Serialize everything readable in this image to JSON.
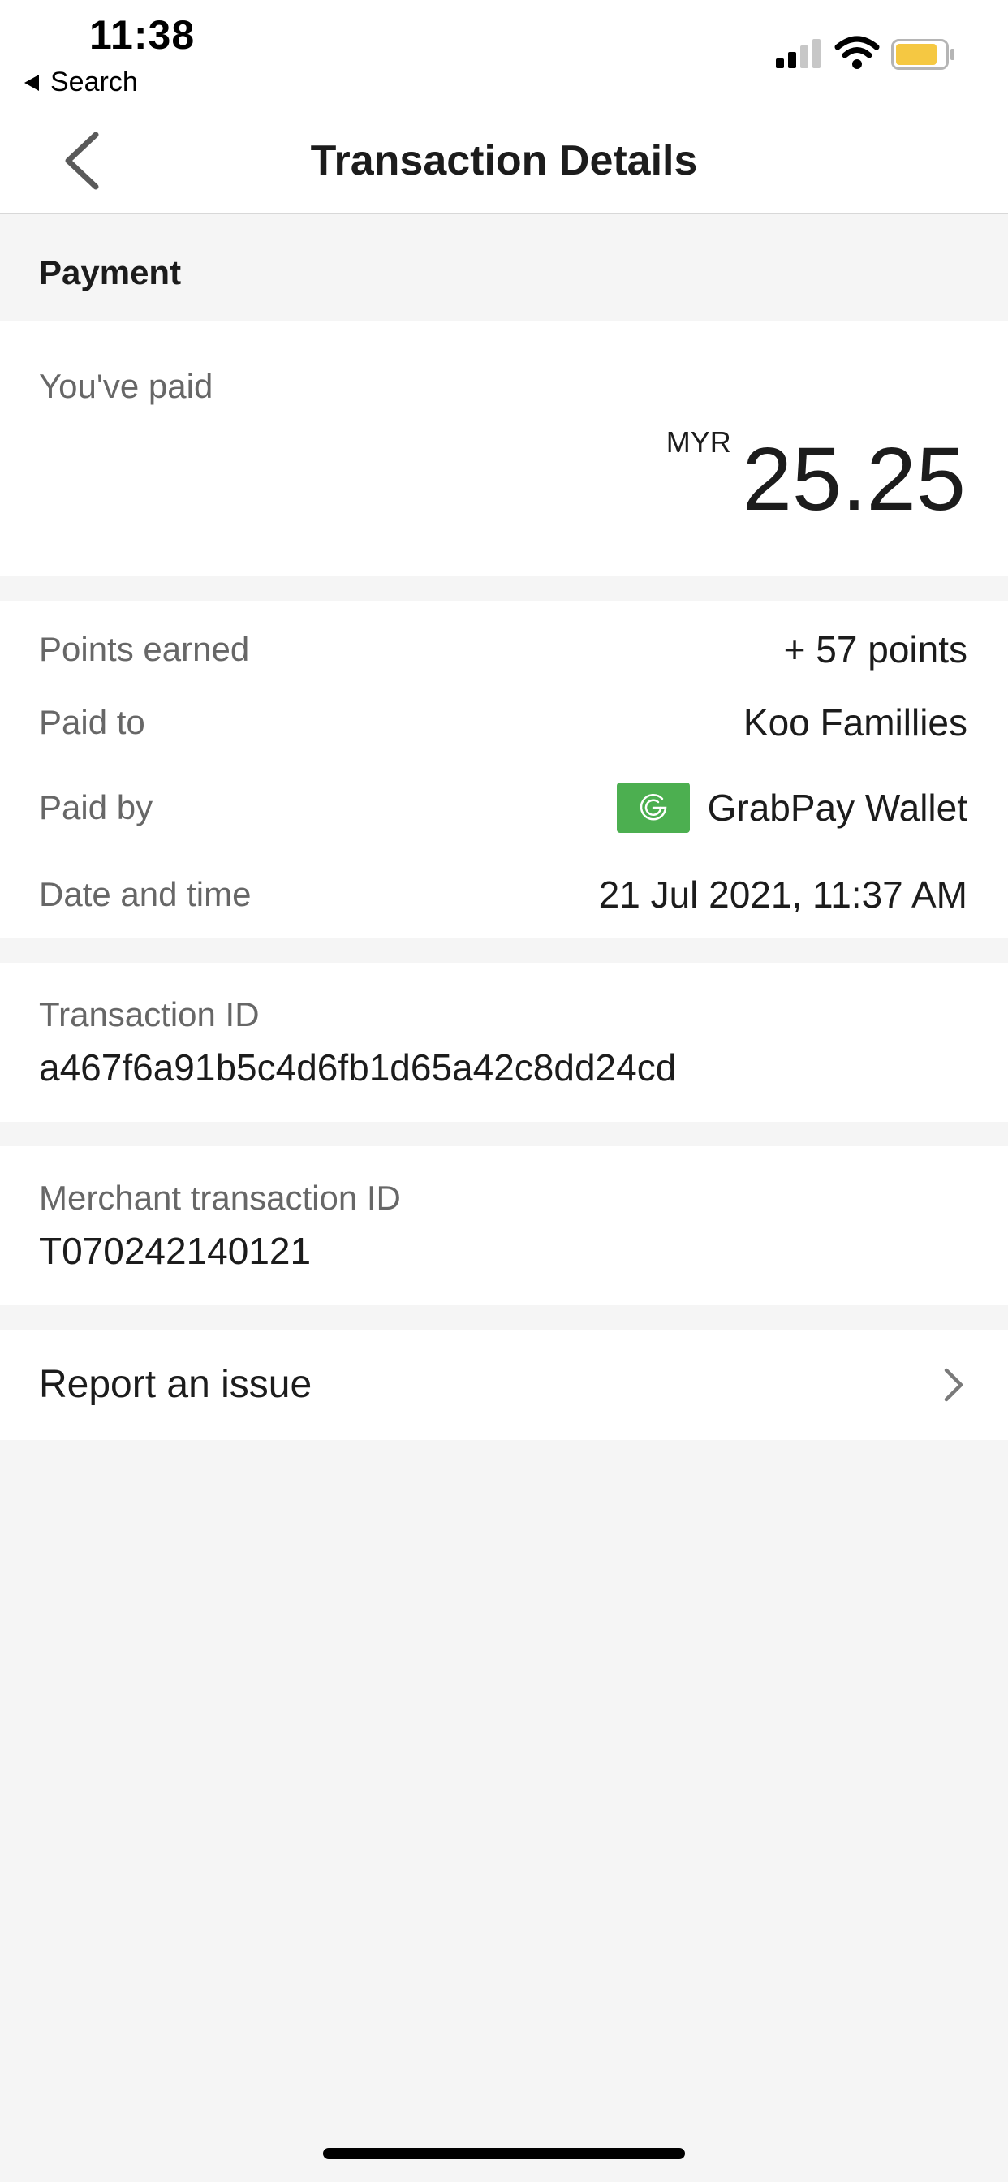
{
  "status_bar": {
    "time": "11:38",
    "back_label": "Search"
  },
  "nav": {
    "title": "Transaction Details"
  },
  "section": {
    "title": "Payment"
  },
  "payment": {
    "paid_label": "You've paid",
    "currency": "MYR",
    "amount": "25.25"
  },
  "details": {
    "points_label": "Points earned",
    "points_value": "+ 57 points",
    "paid_to_label": "Paid to",
    "paid_to_value": "Koo Famillies",
    "paid_by_label": "Paid by",
    "paid_by_value": "GrabPay Wallet",
    "datetime_label": "Date and time",
    "datetime_value": "21 Jul 2021, 11:37 AM"
  },
  "transaction": {
    "label": "Transaction ID",
    "value": "a467f6a91b5c4d6fb1d65a42c8dd24cd"
  },
  "merchant_transaction": {
    "label": "Merchant transaction ID",
    "value": "T070242140121"
  },
  "report": {
    "label": "Report an issue"
  },
  "colors": {
    "grab_green": "#4caf50",
    "battery_yellow": "#f5c842",
    "background": "#f5f5f5"
  },
  "icons": {
    "back": "chevron-left-icon",
    "wallet": "grabpay-logo-icon",
    "report": "chevron-right-icon"
  }
}
